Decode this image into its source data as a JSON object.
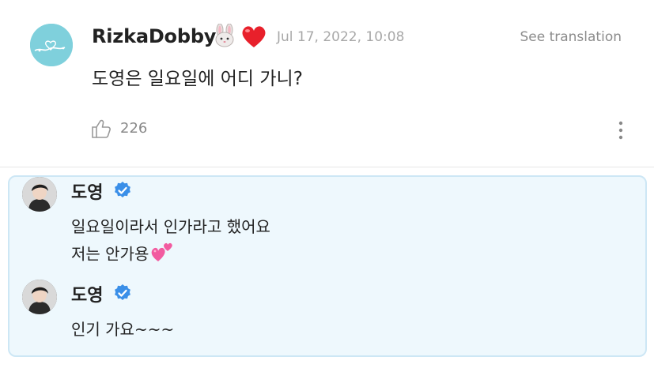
{
  "post": {
    "username": "RizkaDobby",
    "username_emojis": [
      "rabbit-face",
      "red-heart"
    ],
    "timestamp": "Jul 17, 2022, 10:08",
    "translate_label": "See translation",
    "text": "도영은 일요일에 어디 가니?",
    "like_count": "226"
  },
  "replies": [
    {
      "author": "도영",
      "verified": true,
      "lines": [
        "일요일이라서 인가라고 했어요",
        "저는 안가용"
      ],
      "trailing_emoji": "two-hearts"
    },
    {
      "author": "도영",
      "verified": true,
      "lines": [
        "인기 가요~~~"
      ]
    }
  ],
  "colors": {
    "accent_blue": "#3a8fe8",
    "reply_bg": "#eef8fd",
    "reply_border": "#cde7f5",
    "muted_text": "#a8a8a8"
  }
}
